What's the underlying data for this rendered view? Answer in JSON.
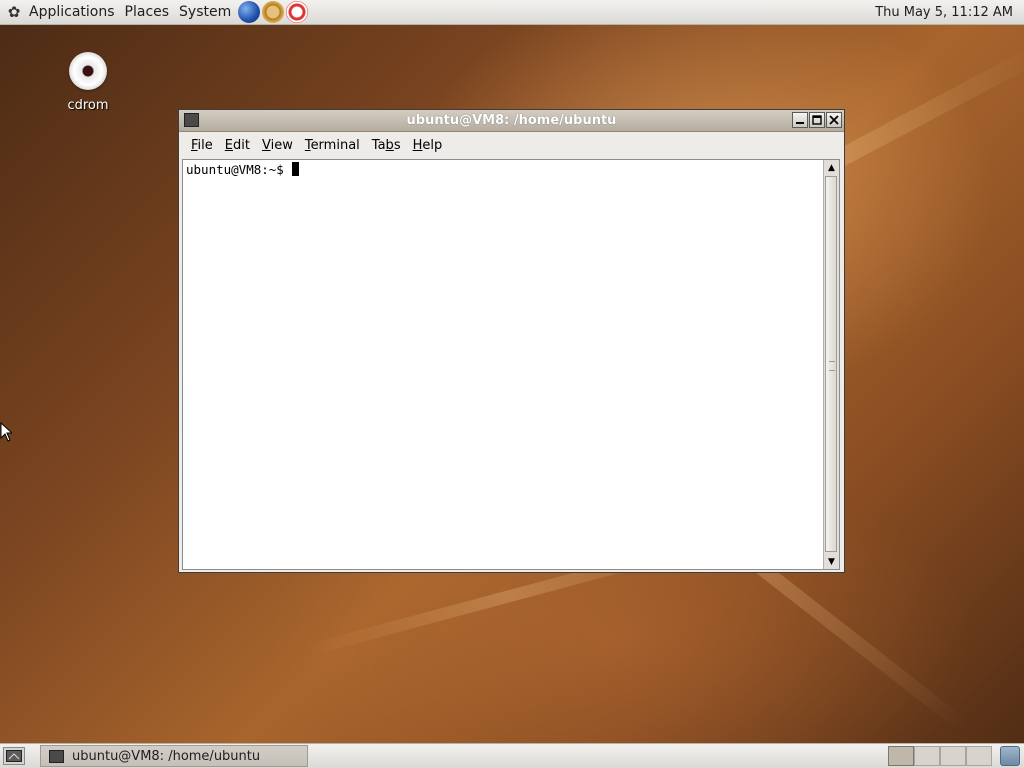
{
  "top_panel": {
    "menus": [
      "Applications",
      "Places",
      "System"
    ],
    "launchers": [
      "web-browser-icon",
      "mail-icon",
      "help-icon"
    ],
    "clock": "Thu May  5, 11:12 AM"
  },
  "desktop": {
    "icons": [
      {
        "label": "cdrom",
        "icon": "cdrom-icon"
      }
    ]
  },
  "terminal_window": {
    "title": "ubuntu@VM8: /home/ubuntu",
    "menus": [
      {
        "label": "File",
        "mnemonic": "F"
      },
      {
        "label": "Edit",
        "mnemonic": "E"
      },
      {
        "label": "View",
        "mnemonic": "V"
      },
      {
        "label": "Terminal",
        "mnemonic": "T"
      },
      {
        "label": "Tabs",
        "mnemonic": "b"
      },
      {
        "label": "Help",
        "mnemonic": "H"
      }
    ],
    "prompt": "ubuntu@VM8:~$ "
  },
  "bottom_panel": {
    "task_label": "ubuntu@VM8: /home/ubuntu",
    "workspace_count": 4,
    "active_workspace": 1
  },
  "colors": {
    "panel": "#dcdad5",
    "titlebar": "#b4ac9f",
    "desktop": "#8a4d22"
  }
}
